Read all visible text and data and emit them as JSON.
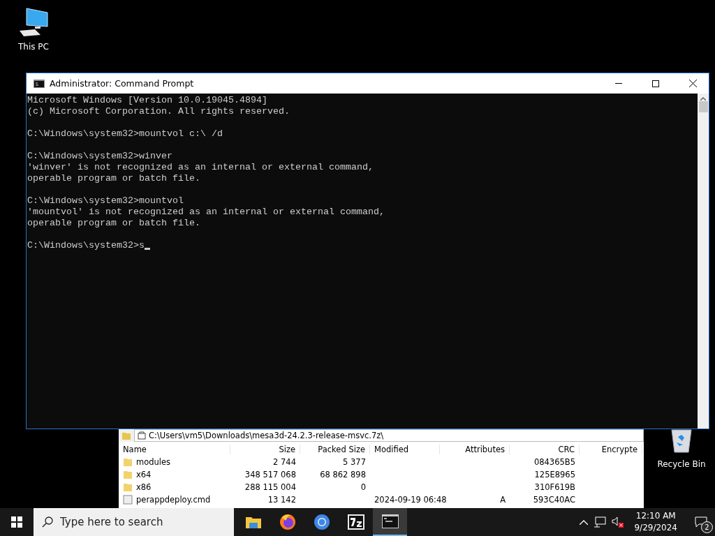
{
  "desktop_icons": [
    {
      "kind": "computer",
      "label": "This PC"
    },
    {
      "kind": "recycle",
      "label": "Recycle Bin"
    }
  ],
  "archive_window": {
    "address": "C:\\Users\\vm5\\Downloads\\mesa3d-24.2.3-release-msvc.7z\\",
    "columns": [
      "Name",
      "Size",
      "Packed Size",
      "Modified",
      "Attributes",
      "CRC",
      "Encrypte"
    ],
    "rows": [
      {
        "kind": "folder",
        "cells": [
          "modules",
          "2 744",
          "5 377",
          "",
          "",
          "084365B5",
          ""
        ]
      },
      {
        "kind": "folder",
        "cells": [
          "x64",
          "348 517 068",
          "68 862 898",
          "",
          "",
          "125E8965",
          ""
        ]
      },
      {
        "kind": "folder",
        "cells": [
          "x86",
          "288 115 004",
          "0",
          "",
          "",
          "310F619B",
          ""
        ]
      },
      {
        "kind": "file",
        "cells": [
          "perappdeploy.cmd",
          "13 142",
          "",
          "2024-09-19 06:48",
          "A",
          "593C40AC",
          ""
        ]
      }
    ]
  },
  "console_window": {
    "title": "Administrator: Command Prompt",
    "blocks": [
      [
        "Microsoft Windows [Version 10.0.19045.4894]",
        "(c) Microsoft Corporation. All rights reserved."
      ],
      [
        "C:\\Windows\\system32>mountvol c:\\ /d"
      ],
      [
        "C:\\Windows\\system32>winver",
        "'winver' is not recognized as an internal or external command,",
        "operable program or batch file."
      ],
      [
        "C:\\Windows\\system32>mountvol",
        "'mountvol' is not recognized as an internal or external command,",
        "operable program or batch file."
      ],
      [
        "C:\\Windows\\system32>s"
      ]
    ]
  },
  "taskbar": {
    "search": {
      "placeholder": "Type here to search"
    },
    "apps": [
      {
        "kind": "explorer",
        "selected": false
      },
      {
        "kind": "firefox",
        "selected": false
      },
      {
        "kind": "chromium",
        "selected": false
      },
      {
        "kind": "sevenzip",
        "selected": false
      },
      {
        "kind": "console",
        "selected": true
      }
    ],
    "clock": {
      "time": "12:10 AM",
      "date": "9/29/2024"
    },
    "notifications": {
      "count": "2"
    }
  }
}
